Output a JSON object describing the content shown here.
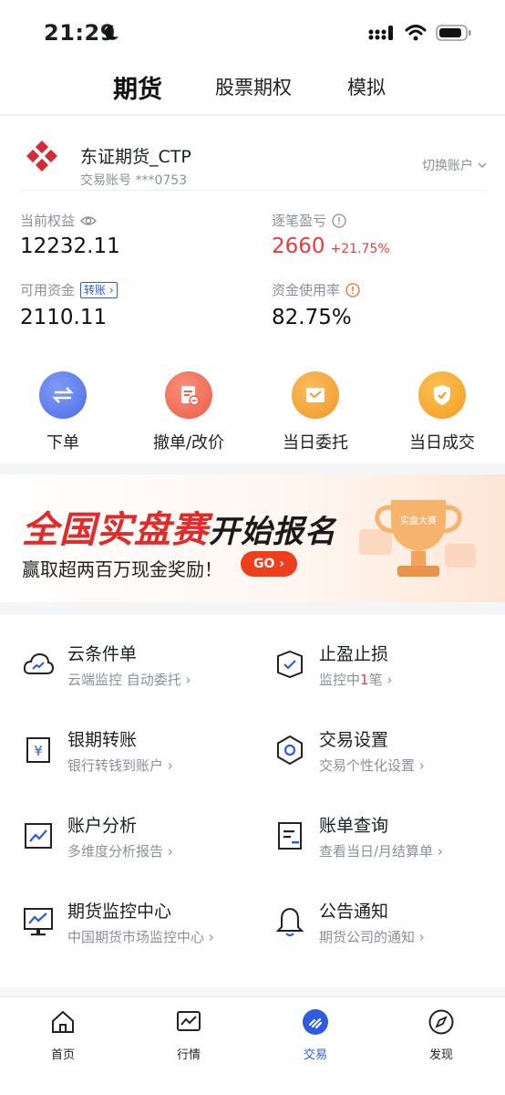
{
  "status": {
    "time": "21:29"
  },
  "top_tabs": [
    "期货",
    "股票期权",
    "模拟"
  ],
  "account": {
    "name": "东证期货_CTP",
    "number": "交易账号 ***0753",
    "switch_label": "切换账户"
  },
  "metrics": {
    "equity_label": "当前权益",
    "equity_value": "12232.11",
    "pnl_label": "逐笔盈亏",
    "pnl_value": "2660",
    "pnl_pct": "+21.75%",
    "available_label": "可用资金",
    "transfer_tag": "转账",
    "available_value": "2110.11",
    "usage_label": "资金使用率",
    "usage_value": "82.75%"
  },
  "quick_actions": [
    {
      "label": "下单",
      "icon": "transfer-arrows-icon",
      "color": "#5b7cf0"
    },
    {
      "label": "撤单/改价",
      "icon": "cancel-order-icon",
      "color": "#f06a55"
    },
    {
      "label": "当日委托",
      "icon": "entrust-icon",
      "color": "#f4a43a"
    },
    {
      "label": "当日成交",
      "icon": "deal-shield-icon",
      "color": "#f7a834"
    }
  ],
  "banner": {
    "title_red": "全国实盘赛",
    "title_black": "开始报名",
    "subtitle": "赢取超两百万现金奖励！",
    "go": "GO",
    "trophy_text": "实盘大赛"
  },
  "services": [
    {
      "title": "云条件单",
      "sub": "云端监控 自动委托",
      "icon": "cloud-icon"
    },
    {
      "title": "止盈止损",
      "sub_pre": "监控中",
      "sub_hl": "1",
      "sub_post": "笔",
      "icon": "shield-check-icon"
    },
    {
      "title": "银期转账",
      "sub": "银行转钱到账户",
      "icon": "yuan-card-icon"
    },
    {
      "title": "交易设置",
      "sub": "交易个性化设置",
      "icon": "hexagon-settings-icon"
    },
    {
      "title": "账户分析",
      "sub": "多维度分析报告",
      "icon": "chart-analysis-icon"
    },
    {
      "title": "账单查询",
      "sub": "查看当日/月结算单",
      "icon": "bill-icon"
    },
    {
      "title": "期货监控中心",
      "sub": "中国期货市场监控中心",
      "icon": "monitor-icon"
    },
    {
      "title": "公告通知",
      "sub": "期货公司的通知",
      "icon": "bell-icon"
    }
  ],
  "tabbar": [
    {
      "label": "首页",
      "icon": "home-icon"
    },
    {
      "label": "行情",
      "icon": "market-chart-icon"
    },
    {
      "label": "交易",
      "icon": "trade-icon",
      "active": true
    },
    {
      "label": "发现",
      "icon": "compass-icon"
    }
  ],
  "colors": {
    "accent": "#2d5be3",
    "red": "#e63b40"
  }
}
